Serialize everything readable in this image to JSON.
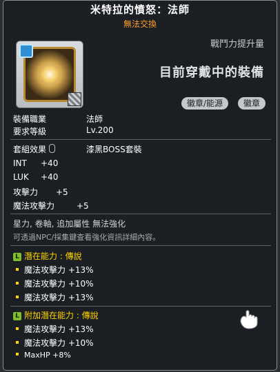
{
  "tooltip": {
    "title": "米特拉的憤怒：法師",
    "subtitle": "無法交換",
    "power_up": "戰鬥力提升量",
    "equipped_label": "目前穿戴中的裝備",
    "chips": [
      "徽章/能源",
      "徽章"
    ],
    "job_label": "裝備職業",
    "job_value": "法師",
    "level_label": "要求等級",
    "level_value": "Lv.200",
    "set_label": "套組效果",
    "set_value": "漆黑BOSS套裝",
    "stats": [
      {
        "label": "INT",
        "value": "+40"
      },
      {
        "label": "LUK",
        "value": "+40"
      },
      {
        "label": "攻擊力",
        "value": "+5"
      },
      {
        "label": "魔法攻擊力",
        "value": "+5"
      }
    ],
    "note1": "星力, 卷軸, 追加屬性 無法強化",
    "note2": "可透過NPC/採集鍵查看強化資訊詳細內容。",
    "potential_badge": "L",
    "potential_head": "潛在能力 : 傳說",
    "potential_lines": [
      "魔法攻擊力 +13%",
      "魔法攻擊力 +10%",
      "魔法攻擊力 +13%"
    ],
    "bonus_head": "附加潛在能力 : 傳說",
    "bonus_lines": [
      "魔法攻擊力 +13%",
      "魔法攻擊力 +10%",
      "MaxHP +8%"
    ]
  },
  "colors": {
    "title": "#ffffff",
    "subtitle": "#ff9f2f",
    "potential": "#ffd400",
    "legend_badge": "#7fbf2a"
  },
  "icons": [
    "emblem-item-icon",
    "mouse-icon",
    "cursor-hand-icon"
  ]
}
